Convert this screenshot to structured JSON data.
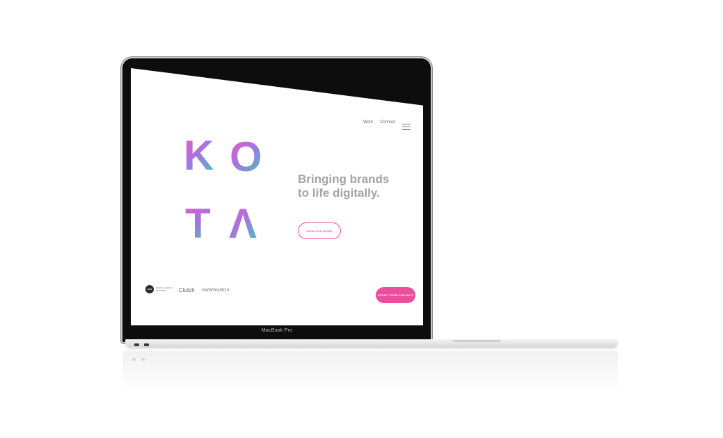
{
  "nav": {
    "work": "Work",
    "connect": "Connect",
    "menu_icon": "hamburger-icon"
  },
  "brand": {
    "letters": [
      "K",
      "O",
      "T",
      "Λ"
    ],
    "gradient": [
      "#e45cb6",
      "#b26de0",
      "#3ec4c5"
    ]
  },
  "hero": {
    "tagline_line1": "Bringing brands",
    "tagline_line2": "to life digitally.",
    "view_work_label": "VIEW OUR WORK"
  },
  "footer": {
    "dan_badge": "DAN",
    "dan_text": "DIGITAL AGENCY NETWORK",
    "clutch": "Clutch",
    "awwwards": "AWWWARDS",
    "start_project_label": "START YOUR PROJECT"
  },
  "device": {
    "label": "MacBook Pro"
  },
  "colors": {
    "accent": "#ea4f9f",
    "tagline": "#a3a3a3"
  }
}
